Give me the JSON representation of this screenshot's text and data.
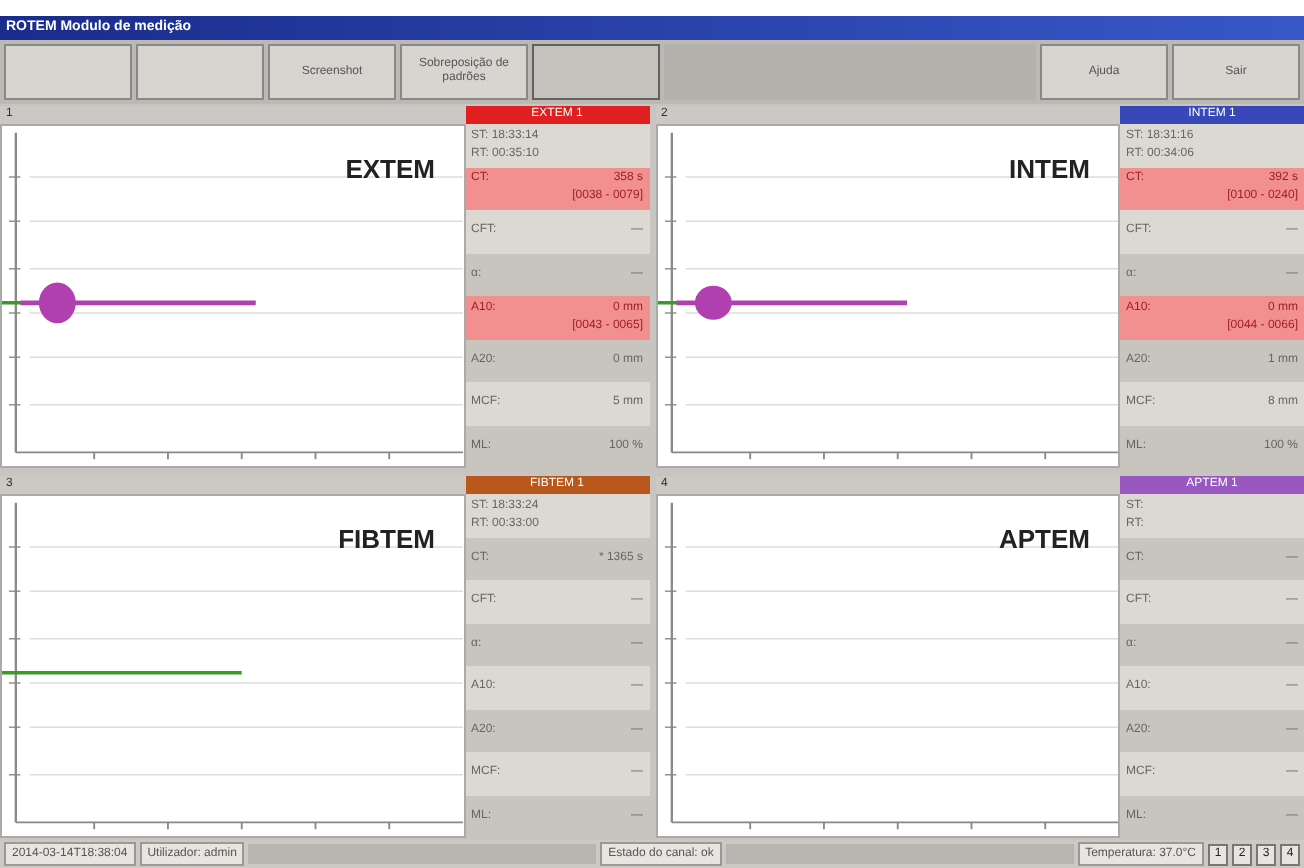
{
  "window": {
    "title": "ROTEM Modulo de medição"
  },
  "toolbar": [
    {
      "disabled": false
    },
    {
      "disabled": false
    },
    {
      "label": "Screenshot",
      "disabled": false
    },
    {
      "label": "Sobreposição de padrões",
      "disabled": false
    },
    {
      "disabled": true
    }
  ],
  "toolbar_right": [
    {
      "label": "Ajuda"
    },
    {
      "label": "Sair"
    }
  ],
  "channels": [
    {
      "number": "1",
      "name": "EXTEM",
      "header": "EXTEM 1",
      "color": "#e02020",
      "st": "ST: 18:33:14",
      "rt": "RT: 00:35:10",
      "results": [
        {
          "label": "CT:",
          "value": "358 s",
          "range": "[0038 - 0079]",
          "abnormal": true
        },
        {
          "label": "CFT:",
          "value": "—",
          "abnormal": false
        },
        {
          "label": "α:",
          "value": "—",
          "abnormal": false
        },
        {
          "label": "A10:",
          "value": "0 mm",
          "range": "[0043 - 0065]",
          "abnormal": true
        },
        {
          "label": "A20:",
          "value": "0 mm",
          "abnormal": false
        },
        {
          "label": "MCF:",
          "value": "5 mm",
          "abnormal": false
        },
        {
          "label": "ML:",
          "value": "100 %",
          "abnormal": false
        }
      ]
    },
    {
      "number": "2",
      "name": "INTEM",
      "header": "INTEM 1",
      "color": "#3848b8",
      "st": "ST: 18:31:16",
      "rt": "RT: 00:34:06",
      "results": [
        {
          "label": "CT:",
          "value": "392 s",
          "range": "[0100 - 0240]",
          "abnormal": true
        },
        {
          "label": "CFT:",
          "value": "—",
          "abnormal": false
        },
        {
          "label": "α:",
          "value": "—",
          "abnormal": false
        },
        {
          "label": "A10:",
          "value": "0 mm",
          "range": "[0044 - 0066]",
          "abnormal": true
        },
        {
          "label": "A20:",
          "value": "1 mm",
          "abnormal": false
        },
        {
          "label": "MCF:",
          "value": "8 mm",
          "abnormal": false
        },
        {
          "label": "ML:",
          "value": "100 %",
          "abnormal": false
        }
      ]
    },
    {
      "number": "3",
      "name": "FIBTEM",
      "header": "FIBTEM 1",
      "color": "#b8581c",
      "st": "ST: 18:33:24",
      "rt": "RT: 00:33:00",
      "results": [
        {
          "label": "CT:",
          "value": "* 1365 s",
          "abnormal": false
        },
        {
          "label": "CFT:",
          "value": "—",
          "abnormal": false
        },
        {
          "label": "α:",
          "value": "—",
          "abnormal": false
        },
        {
          "label": "A10:",
          "value": "—",
          "abnormal": false
        },
        {
          "label": "A20:",
          "value": "—",
          "abnormal": false
        },
        {
          "label": "MCF:",
          "value": "—",
          "abnormal": false
        },
        {
          "label": "ML:",
          "value": "—",
          "abnormal": false
        }
      ]
    },
    {
      "number": "4",
      "name": "APTEM",
      "header": "APTEM 1",
      "color": "#9858c0",
      "st": "ST:",
      "rt": "RT:",
      "results": [
        {
          "label": "CT:",
          "value": "—",
          "abnormal": false
        },
        {
          "label": "CFT:",
          "value": "—",
          "abnormal": false
        },
        {
          "label": "α:",
          "value": "—",
          "abnormal": false
        },
        {
          "label": "A10:",
          "value": "—",
          "abnormal": false
        },
        {
          "label": "A20:",
          "value": "—",
          "abnormal": false
        },
        {
          "label": "MCF:",
          "value": "—",
          "abnormal": false
        },
        {
          "label": "ML:",
          "value": "—",
          "abnormal": false
        }
      ]
    }
  ],
  "status_bar": {
    "timestamp": "2014-03-14T18:38:04",
    "user": "Utilizador: admin",
    "channel_state": "Estado do canal: ok",
    "temperature": "Temperatura: 37.0°C",
    "channel_buttons": [
      "1",
      "2",
      "3",
      "4"
    ]
  }
}
